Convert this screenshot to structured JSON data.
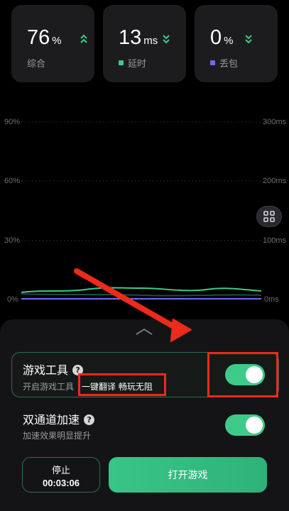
{
  "stats": [
    {
      "value": "76",
      "unit": "%",
      "label": "综合",
      "trend": "up-chevrons",
      "dot_color": null
    },
    {
      "value": "13",
      "unit": "ms",
      "label": "延时",
      "trend": "down-chevrons",
      "dot_color": "#3ecb8a"
    },
    {
      "value": "0",
      "unit": "%",
      "label": "丢包",
      "trend": "down-chevrons",
      "dot_color": "#6b6bf0"
    }
  ],
  "chart": {
    "left_ticks": [
      "90%",
      "60%",
      "30%",
      "0%"
    ],
    "right_ticks": [
      "300ms",
      "200ms",
      "100ms",
      "0ms"
    ],
    "series_colors": {
      "quality": "#2f6b55",
      "latency": "#3ecb8a",
      "loss": "#6b6bf0"
    }
  },
  "tools": {
    "game_tools_title": "游戏工具",
    "game_tools_sub": "开启游戏工具",
    "game_tools_highlight": "一键翻译 畅玩无阻",
    "game_tools_enabled": true,
    "dual_channel_title": "双通道加速",
    "dual_channel_sub": "加速效果明显提升",
    "dual_channel_enabled": true,
    "help_glyph": "?"
  },
  "footer": {
    "stop_label": "停止",
    "timer": "00:03:06",
    "open_game_label": "打开游戏"
  },
  "colors": {
    "accent": "#3ecb8a",
    "annotation": "#ee2a1a"
  }
}
